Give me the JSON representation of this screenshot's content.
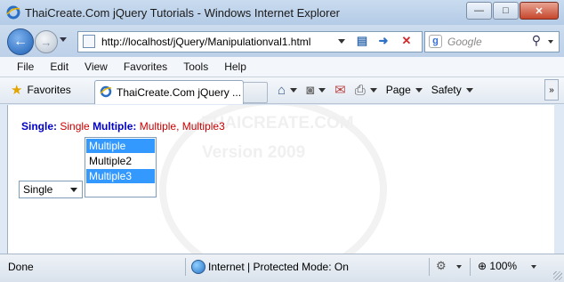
{
  "window": {
    "title": "ThaiCreate.Com jQuery Tutorials - Windows Internet Explorer",
    "minimize_glyph": "—",
    "maximize_glyph": "□",
    "close_glyph": "✕"
  },
  "address_bar": {
    "url": "http://localhost/jQuery/Manipulationval1.html"
  },
  "search": {
    "placeholder": "Google"
  },
  "menu": {
    "items": [
      "File",
      "Edit",
      "View",
      "Favorites",
      "Tools",
      "Help"
    ]
  },
  "favorites_bar": {
    "favorites_label": "Favorites",
    "tab_label": "ThaiCreate.Com jQuery ...",
    "page_label": "Page",
    "safety_label": "Safety"
  },
  "content": {
    "single_label": "Single:",
    "single_value": "Single",
    "multiple_label": "Multiple:",
    "multiple_value": "Multiple, Multiple3",
    "single_select_value": "Single",
    "multi_options": [
      {
        "label": "Multiple",
        "selected": true
      },
      {
        "label": "Multiple2",
        "selected": false
      },
      {
        "label": "Multiple3",
        "selected": true
      }
    ],
    "watermark_line1": "THAICREATE.COM",
    "watermark_line2": "Version 2009"
  },
  "status_bar": {
    "status": "Done",
    "zone": "Internet | Protected Mode: On",
    "zoom": "100%"
  },
  "colors": {
    "label_blue": "#0000cc",
    "value_red": "#cc0000",
    "selection": "#3399ff"
  }
}
